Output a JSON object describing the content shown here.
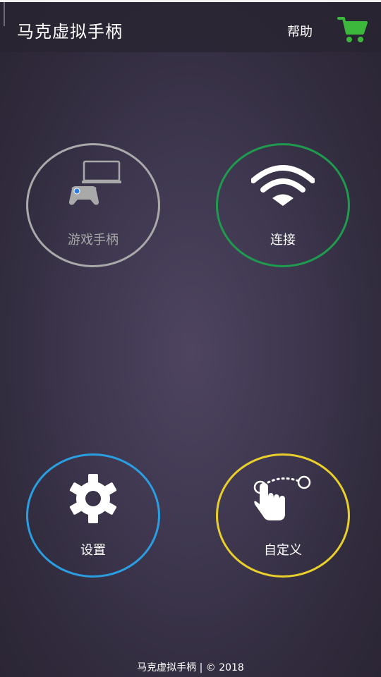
{
  "header": {
    "title": "马克虚拟手柄",
    "help_label": "帮助",
    "cart_icon": "shopping-cart-icon",
    "cart_color": "#3cb83c"
  },
  "tiles": [
    {
      "label": "游戏手柄",
      "icon": "laptop-gamepad-icon",
      "color": "#a9a9a9"
    },
    {
      "label": "连接",
      "icon": "wifi-icon",
      "color": "#1f9a4e"
    },
    {
      "label": "设置",
      "icon": "gear-icon",
      "color": "#2a9ee0"
    },
    {
      "label": "自定义",
      "icon": "touch-gesture-icon",
      "color": "#e8cf2b"
    }
  ],
  "footer": {
    "text": "马克虚拟手柄 | © 2018"
  }
}
